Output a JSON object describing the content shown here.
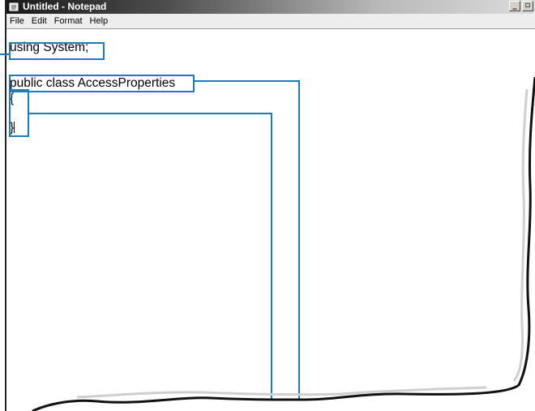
{
  "window": {
    "title": "Untitled - Notepad",
    "controls": {
      "minimize": "_",
      "maximize": "▫"
    }
  },
  "menu": [
    "File",
    "Edit",
    "Format",
    "Help"
  ],
  "editor": {
    "lines": [
      "using System;",
      "",
      "public class AccessProperties",
      "{",
      "",
      "}"
    ]
  },
  "colors": {
    "callout": "#1a7bb8",
    "titlebar_dark": "#1a1a1a"
  }
}
